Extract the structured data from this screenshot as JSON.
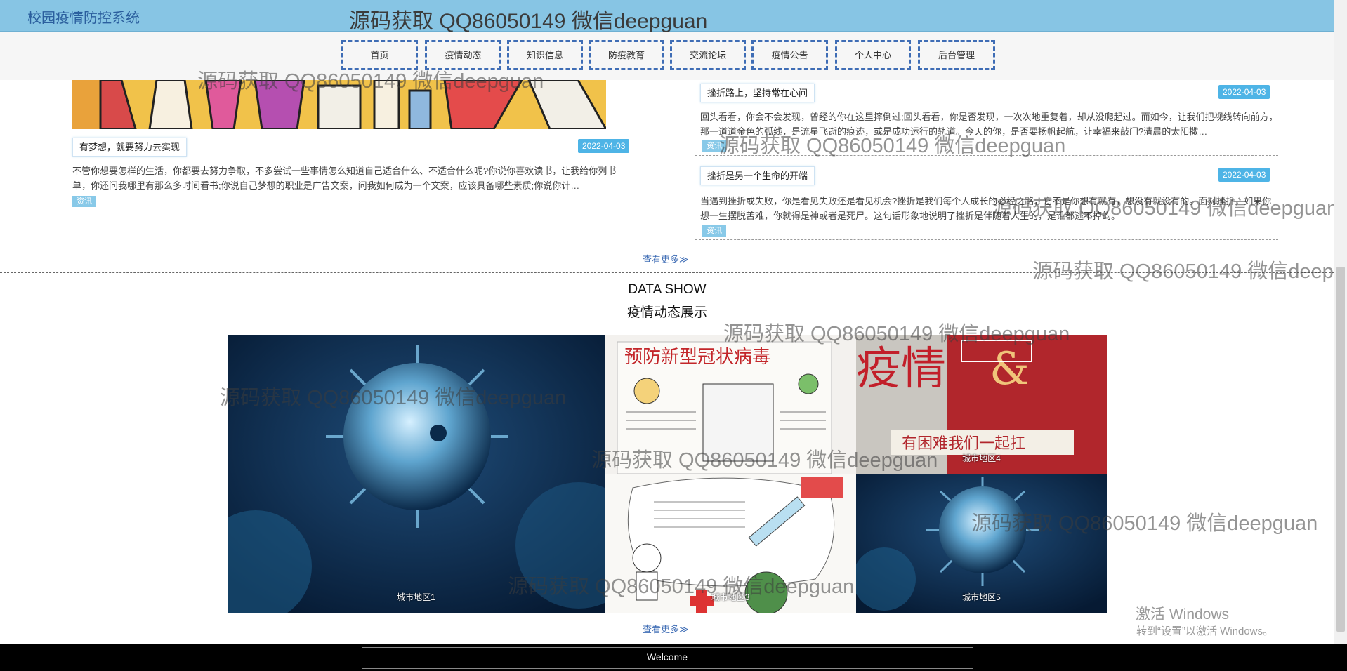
{
  "header": {
    "app_title": "校园疫情防控系统",
    "banner_text": "源码获取 QQ86050149 微信deepguan"
  },
  "nav": {
    "items": [
      "首页",
      "疫情动态",
      "知识信息",
      "防疫教育",
      "交流论坛",
      "疫情公告",
      "个人中心",
      "后台管理"
    ]
  },
  "news": {
    "left": {
      "title": "有梦想，就要努力去实现",
      "date": "2022-04-03",
      "text": "不管你想要怎样的生活，你都要去努力争取，不多尝试一些事情怎么知道自己适合什么、不适合什么呢?你说你喜欢读书，让我给你列书单，你还问我哪里有那么多时间看书;你说自己梦想的职业是广告文案，问我如何成为一个文案，应该具备哪些素质;你说你计…",
      "tag": "资讯"
    },
    "right": [
      {
        "title": "挫折路上，坚持常在心间",
        "date": "2022-04-03",
        "text": "回头看看，你会不会发现，曾经的你在这里摔倒过;回头看看，你是否发现，一次次地重复着，却从没爬起过。而如今，让我们把视线转向前方，那一道道金色的弧线，是流星飞逝的痕迹，或是成功运行的轨道。今天的你，是否要扬帆起航，让幸福来敲门?清晨的太阳撒…",
        "tag": "资讯"
      },
      {
        "title": "挫折是另一个生命的开端",
        "date": "2022-04-03",
        "text": "当遇到挫折或失败，你是看见失败还是看见机会?挫折是我们每个人成长的必经之路，它不是你想有就有，想没有就没有的。面对挫折，如果你想一生摆脱苦难，你就得是神或者是死尸。这句话形象地说明了挫折是伴随着人生的，是谁都逃不掉的。",
        "tag": "资讯"
      }
    ],
    "more_label": "查看更多≫"
  },
  "section": {
    "title_en": "DATA SHOW",
    "title_cn": "疫情动态展示",
    "gallery": [
      {
        "label": "城市地区1",
        "image": "virus-photo"
      },
      {
        "label": "",
        "image": "poster-drawing"
      },
      {
        "label": "城市地区4",
        "image": "red-poster"
      },
      {
        "label": "城市地区3",
        "image": "vaccine-drawing"
      },
      {
        "label": "城市地区5",
        "image": "virus-photo"
      }
    ],
    "more_label": "查看更多≫"
  },
  "watermark": "源码获取 QQ86050149 微信deepguan",
  "system": {
    "activate_title": "激活 Windows",
    "activate_sub": "转到“设置”以激活 Windows。"
  },
  "footer": {
    "welcome": "Welcome"
  }
}
